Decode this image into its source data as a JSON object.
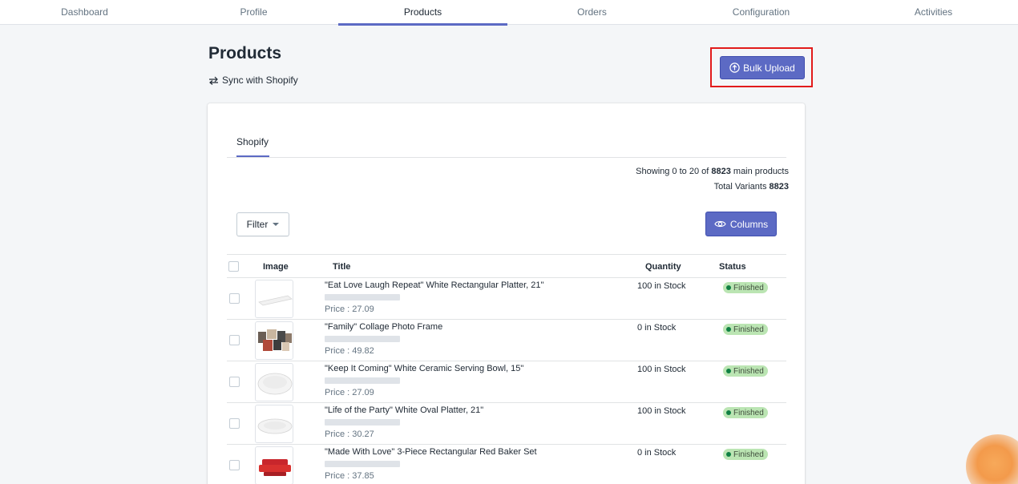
{
  "nav": {
    "tabs": [
      {
        "label": "Dashboard"
      },
      {
        "label": "Profile"
      },
      {
        "label": "Products"
      },
      {
        "label": "Orders"
      },
      {
        "label": "Configuration"
      },
      {
        "label": "Activities"
      }
    ],
    "active": "Products"
  },
  "header": {
    "title": "Products",
    "sync_label": "Sync with Shopify",
    "bulk_upload_label": "Bulk Upload"
  },
  "card": {
    "tab_label": "Shopify",
    "showing_prefix": "Showing 0 to 20 of ",
    "showing_count": "8823",
    "showing_suffix": " main products",
    "variants_prefix": "Total Variants ",
    "variants_count": "8823",
    "filter_label": "Filter",
    "columns_label": "Columns"
  },
  "table": {
    "columns": [
      "Image",
      "Title",
      "Quantity",
      "Status"
    ],
    "rows": [
      {
        "title": "\"Eat Love Laugh Repeat\" White Rectangular Platter, 21\"",
        "price": "Price : 27.09",
        "quantity": "100 in Stock",
        "status": "Finished",
        "image": "white-platter"
      },
      {
        "title": "\"Family\" Collage Photo Frame",
        "price": "Price : 49.82",
        "quantity": "0 in Stock",
        "status": "Finished",
        "image": "photo-frame"
      },
      {
        "title": "\"Keep It Coming\" White Ceramic Serving Bowl, 15\"",
        "price": "Price : 27.09",
        "quantity": "100 in Stock",
        "status": "Finished",
        "image": "white-bowl"
      },
      {
        "title": "\"Life of the Party\" White Oval Platter, 21\"",
        "price": "Price : 30.27",
        "quantity": "100 in Stock",
        "status": "Finished",
        "image": "oval-platter"
      },
      {
        "title": "\"Made With Love\" 3-Piece Rectangular Red Baker Set",
        "price": "Price : 37.85",
        "quantity": "0 in Stock",
        "status": "Finished",
        "image": "red-baker"
      }
    ]
  },
  "colors": {
    "accent": "#5c6ac4",
    "highlight": "#e21b1b",
    "badge_bg": "#bbe5b3",
    "badge_dot": "#108043"
  }
}
